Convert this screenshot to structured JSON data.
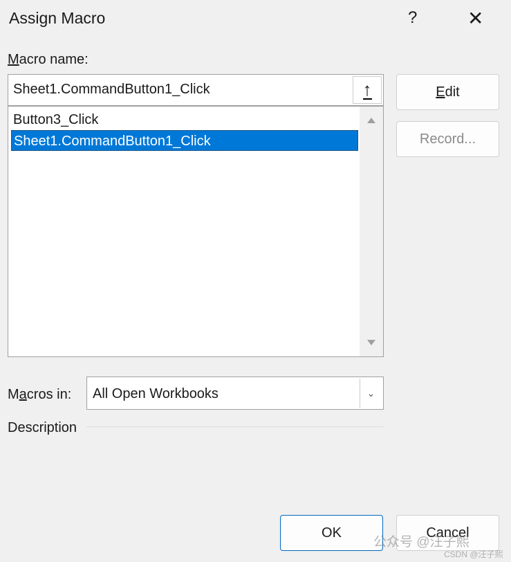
{
  "dialog": {
    "title": "Assign Macro",
    "help": "?",
    "close": "✕"
  },
  "macro_name": {
    "label_accel": "M",
    "label_rest": "acro name:",
    "value": "Sheet1.CommandButton1_Click",
    "up_icon": "↑"
  },
  "macro_list": {
    "items": [
      "Button3_Click",
      "Sheet1.CommandButton1_Click"
    ],
    "selected_index": 1
  },
  "buttons": {
    "edit_accel": "E",
    "edit_rest": "dit",
    "record": "Record...",
    "ok": "OK",
    "cancel": "Cancel"
  },
  "macros_in": {
    "label_pre": "M",
    "label_accel": "a",
    "label_rest": "cros in:",
    "value": "All Open Workbooks"
  },
  "description": {
    "label": "Description"
  },
  "watermark": {
    "line1": "公众号 @汪子熙",
    "line2": "CSDN @汪子熙"
  }
}
